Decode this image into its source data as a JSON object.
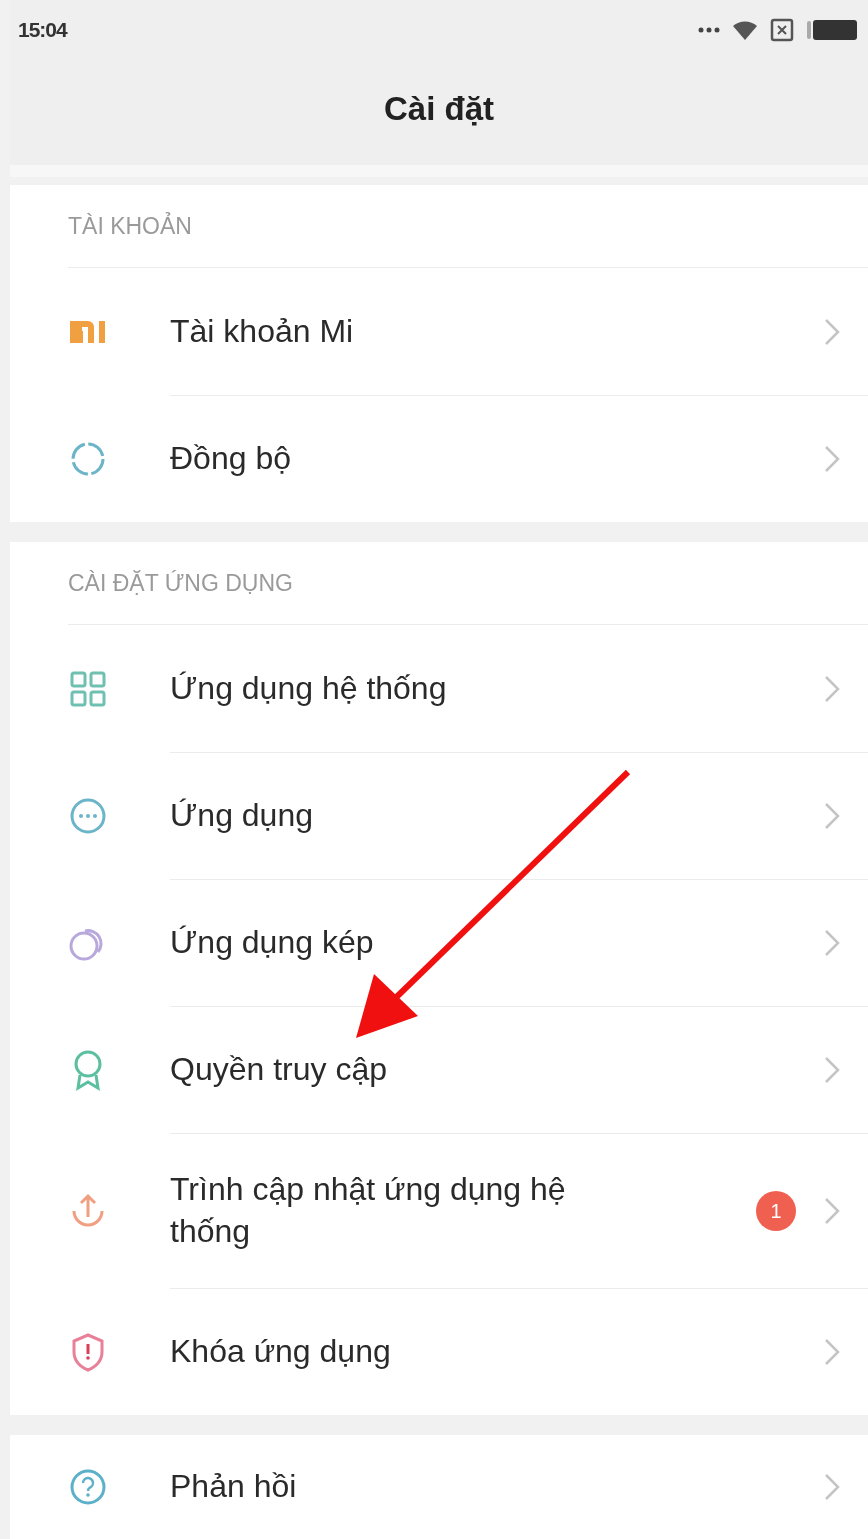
{
  "status_bar": {
    "time": "15:04"
  },
  "header": {
    "title": "Cài đặt"
  },
  "sections": [
    {
      "heading": "TÀI KHOẢN",
      "items": [
        {
          "kind": "logo",
          "label": "Tài khoản Mi"
        },
        {
          "kind": "sync",
          "label": "Đồng bộ"
        }
      ]
    },
    {
      "heading": "CÀI ĐẶT ỨNG DỤNG",
      "items": [
        {
          "kind": "grid",
          "label": "Ứng dụng hệ thống"
        },
        {
          "kind": "chat",
          "label": "Ứng dụng"
        },
        {
          "kind": "dual",
          "label": "Ứng dụng kép"
        },
        {
          "kind": "ribbon",
          "label": "Quyền truy cập"
        },
        {
          "kind": "upload",
          "label": "Trình cập nhật ứng dụng hệ thống",
          "badge": "1"
        },
        {
          "kind": "shield",
          "label": "Khóa ứng dụng"
        }
      ]
    },
    {
      "items": [
        {
          "kind": "help",
          "label": "Phản hồi"
        }
      ]
    }
  ]
}
